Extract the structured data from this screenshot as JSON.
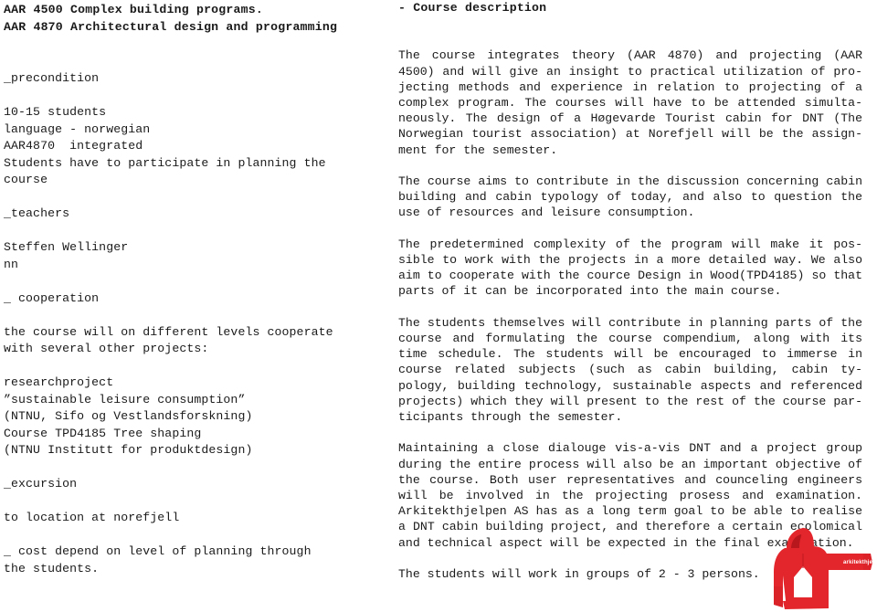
{
  "document": {
    "left_column": {
      "title_lines": [
        "AAR 4500 Complex building programs.",
        "AAR 4870 Architectural design and programming"
      ],
      "sections": [
        {
          "heading": "_precondition",
          "body": "10-15 students\nlanguage - norwegian\nAAR4870  integrated\nStudents have to participate in planning the\ncourse"
        },
        {
          "heading": "_teachers",
          "body": "Steffen Wellinger\nnn"
        },
        {
          "heading": "_ cooperation",
          "body": "the course will on different levels cooperate\nwith several other projects:\n\nresearchproject\n”sustainable leisure consumption”\n(NTNU, Sifo og Vestlandsforskning)\nCourse TPD4185 Tree shaping\n(NTNU Institutt for produktdesign)"
        },
        {
          "heading": "_excursion",
          "body": "to location at norefjell"
        },
        {
          "heading": "",
          "body": "_ cost depend on level of planning through\nthe students."
        }
      ]
    },
    "right_column": {
      "heading": "- Course description",
      "paragraphs": [
        "The course integrates theory (AAR 4870) and projecting (AAR 4500) and will give an insight to practical utilization of pro-jecting methods and experience in relation to projecting of a complex program.  The courses will have to be attended simulta-neously. The design of a Høgevarde Tourist cabin for DNT (The Norwegian tourist association) at Norefjell will be the assign-ment for the semester.",
        "The course aims to contribute in the discussion concerning cabin building and cabin typology of today, and also to question the use of resources and leisure consumption.",
        "The predetermined complexity of the program will make it pos-sible to work with the projects in a more detailed way. We also aim to cooperate with the cource Design in Wood(TPD4185) so that parts of it can be incorporated into the main course.",
        "The students themselves will contribute in planning parts of the course and formulating the course compendium, along with its time schedule. The students will be encouraged to immerse in course related subjects (such as cabin building, cabin ty-pology, building technology, sustainable aspects and referenced projects) which they will present to the rest of the course par-ticipants through the semester.",
        "Maintaining a close dialouge vis-a-vis DNT and a project group during the entire process will also be an important objective of the course. Both user representatives and counceling engineers will be involved in the projecting prosess and  examination. Arkitekthjelpen AS has as a long term goal to be able to realise a DNT cabin building project, and therefore a certain ecolomical and technical aspect will be expected in the final examination.",
        "The students will work in groups of 2 - 3 persons."
      ]
    },
    "logo": {
      "name": "arkitekthjelpen-jacket-logo",
      "sleeve_text": "arkitekthjelpen",
      "red": "#e3262c",
      "red_dark": "#c01a20",
      "white": "#ffffff"
    }
  }
}
